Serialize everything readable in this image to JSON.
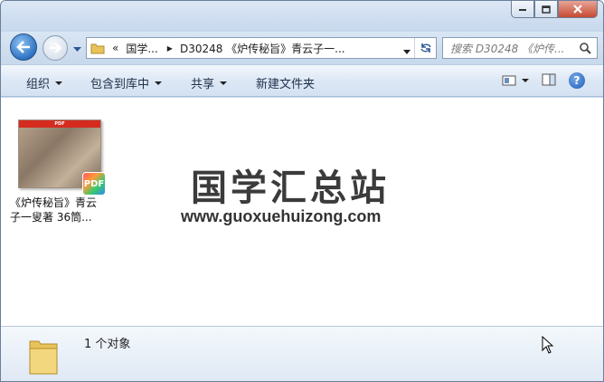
{
  "window": {
    "controls": [
      "minimize",
      "maximize",
      "close"
    ]
  },
  "address": {
    "overflow": "«",
    "crumbs": [
      "国学...",
      "D30248 《炉传秘旨》青云子一..."
    ]
  },
  "search": {
    "placeholder": "搜索 D30248 《炉传..."
  },
  "commands": {
    "organize": "组织",
    "include_library": "包含到库中",
    "share": "共享",
    "new_folder": "新建文件夹"
  },
  "file": {
    "thumb_banner": "PDF",
    "badge": "PDF",
    "name_line1": "《炉传秘旨》青云",
    "name_line2": "子一叟著 36筒..."
  },
  "watermark": {
    "title": "国学汇总站",
    "url": "www.guoxuehuizong.com"
  },
  "details": {
    "count_text": "1 个对象"
  },
  "colors": {
    "pdf_red": "#d52b1e",
    "folder_yellow": "#e8c25a"
  }
}
